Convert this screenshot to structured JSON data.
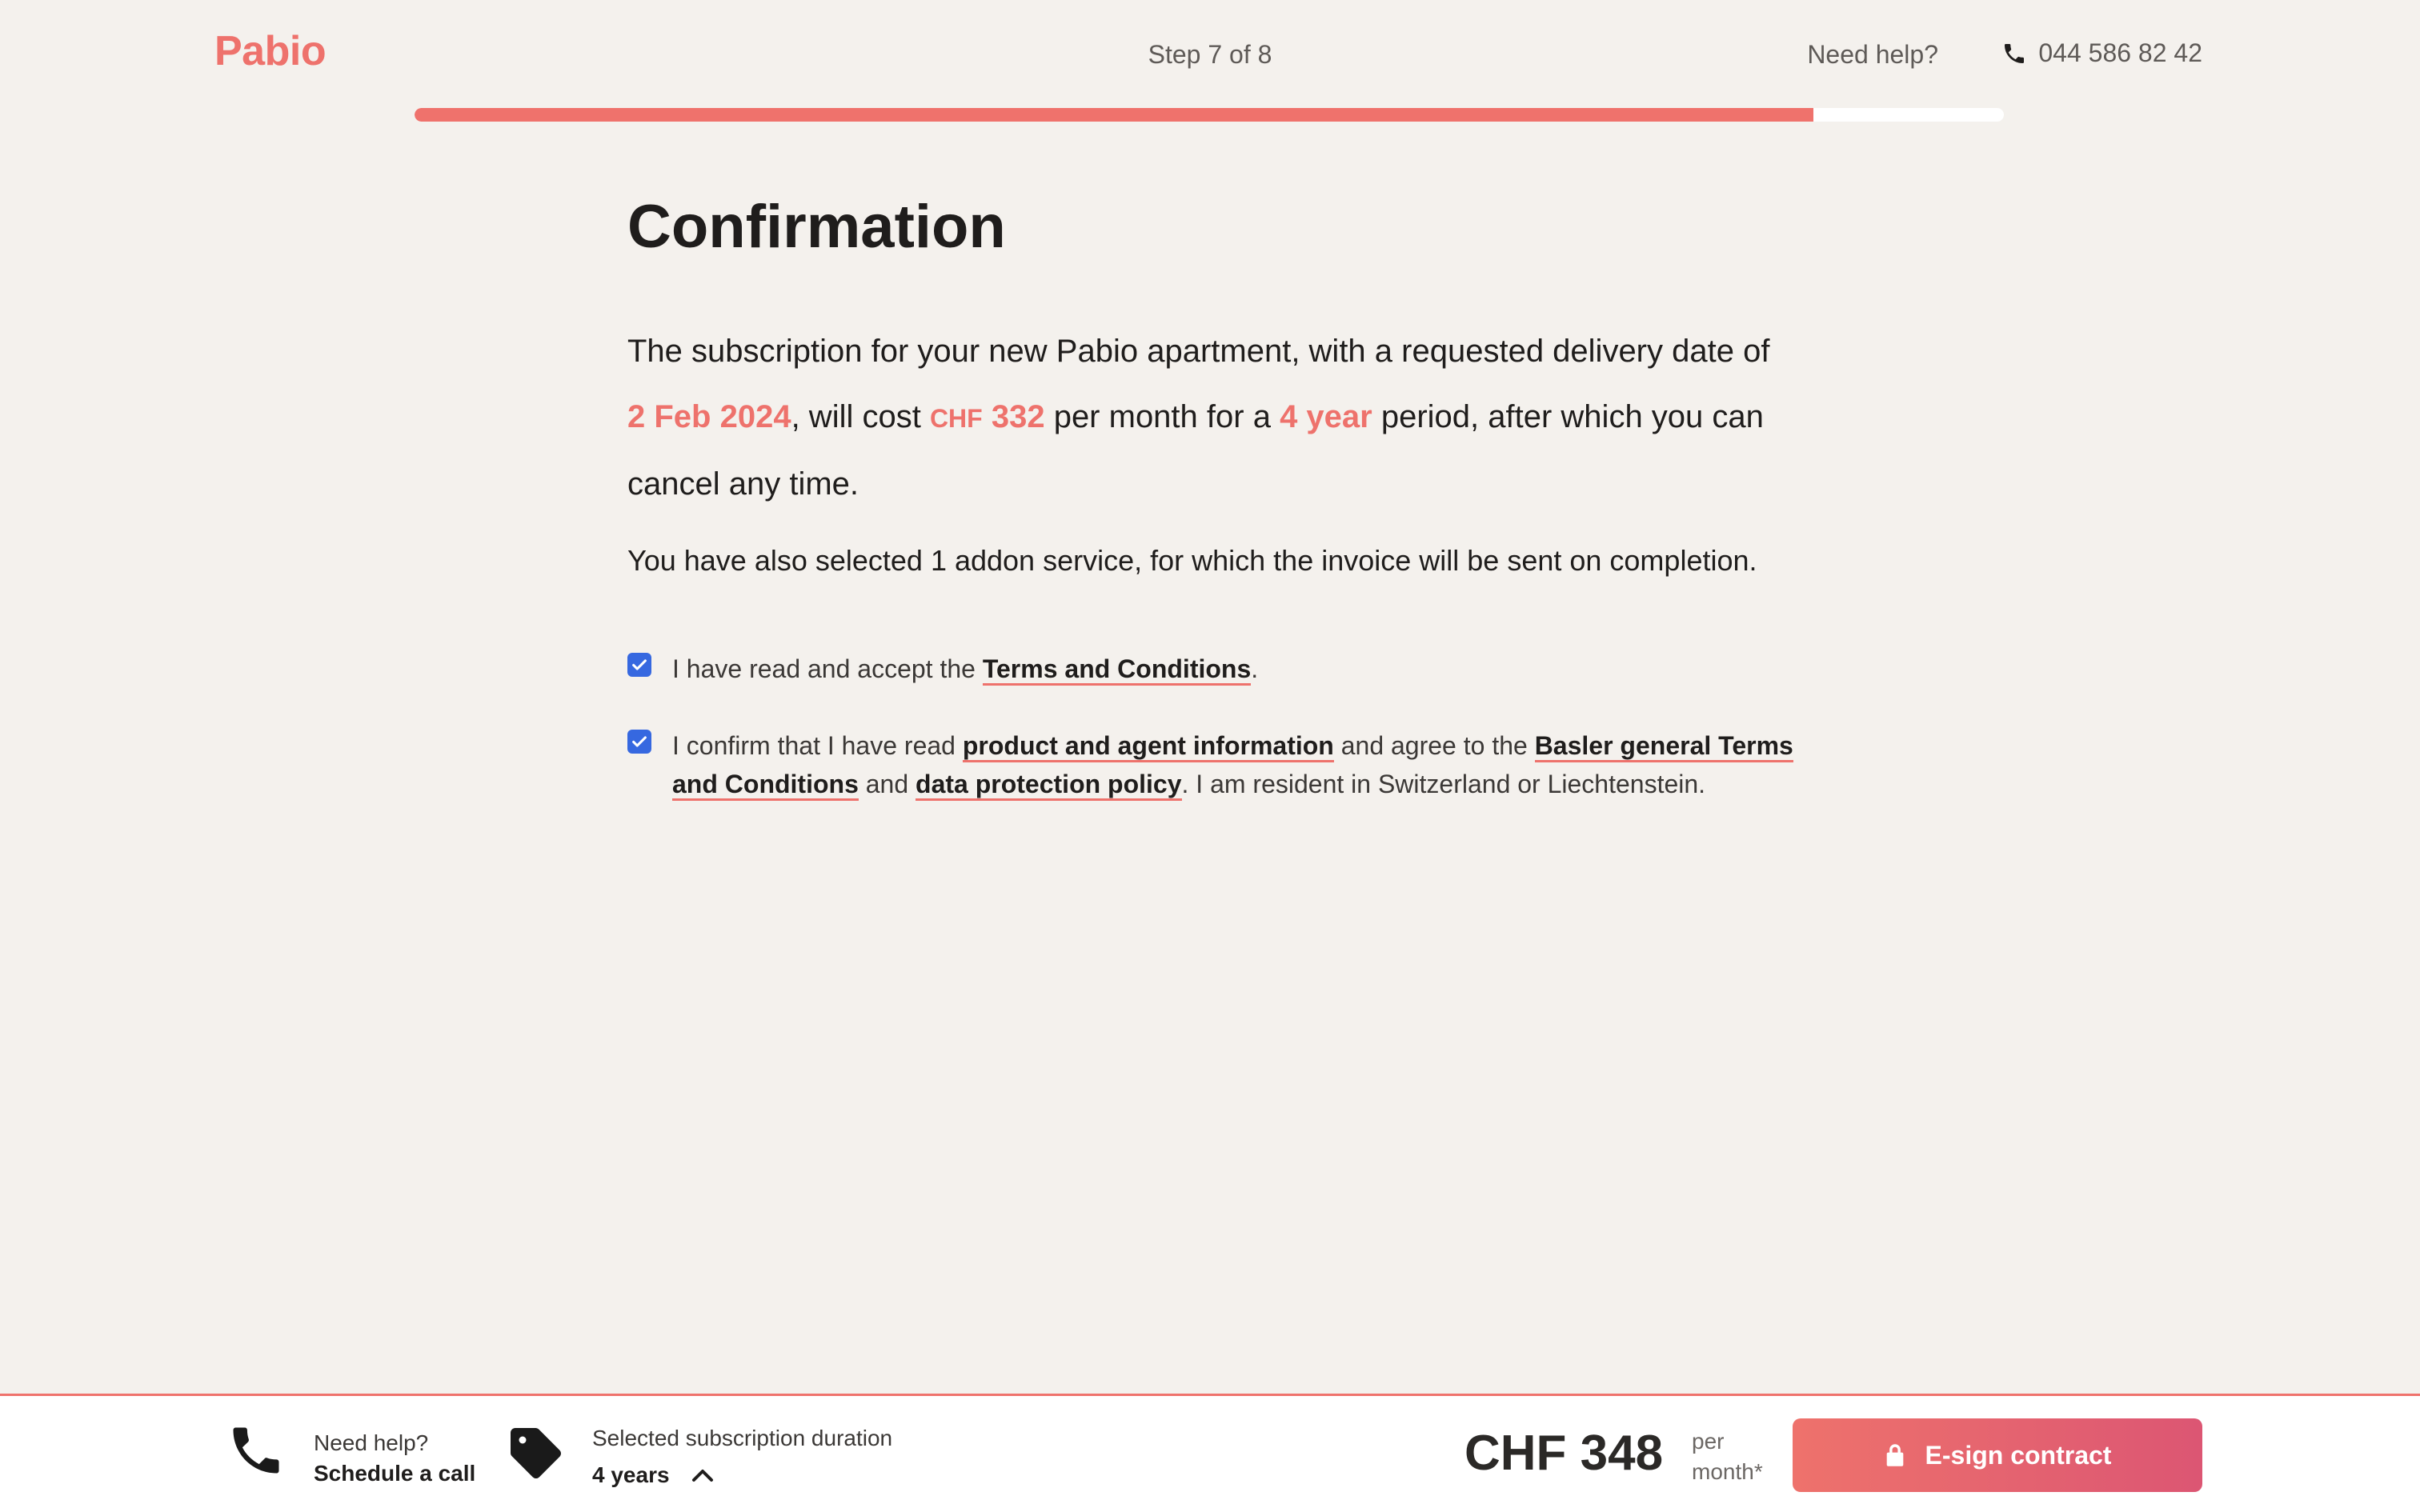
{
  "header": {
    "logo": "Pabio",
    "step": "Step 7 of 8",
    "help": "Need help?",
    "phone": "044 586 82 42",
    "progress": 0.88
  },
  "main": {
    "title": "Confirmation",
    "lead": {
      "p1": "The subscription for your new Pabio apartment, with a requested delivery date of ",
      "date": "2 Feb 2024",
      "p2": ", will cost ",
      "currency": "CHF",
      "amount": "332",
      "p3": " per month for a ",
      "duration": "4 year",
      "p4": " period, after which you can cancel any time."
    },
    "addon": "You have also selected 1 addon service, for which the invoice will be sent on completion.",
    "check1": {
      "checked": true,
      "before": "I have read and accept the ",
      "link": "Terms and Conditions",
      "after": "."
    },
    "check2": {
      "checked": true,
      "before": "I confirm that I have read ",
      "link1": "product and agent information",
      "mid1": " and agree to the ",
      "link2": "Basler general Terms and Conditions",
      "mid2": " and ",
      "link3": "data protection policy",
      "after": ". I am resident in Switzerland or Liechtenstein."
    }
  },
  "footer": {
    "help_label": "Need help?",
    "schedule": "Schedule a call",
    "duration_label": "Selected subscription duration",
    "duration_value": "4 years",
    "price": "CHF 348",
    "per": "per",
    "month": "month*",
    "cta": "E-sign contract"
  },
  "colors": {
    "accent": "#ee726c",
    "background": "#f4f1ed",
    "checkbox": "#3668e0"
  },
  "icons": [
    "phone-icon",
    "checkbox-check-icon",
    "price-tag-icon",
    "chevron-up-icon",
    "lock-icon"
  ]
}
